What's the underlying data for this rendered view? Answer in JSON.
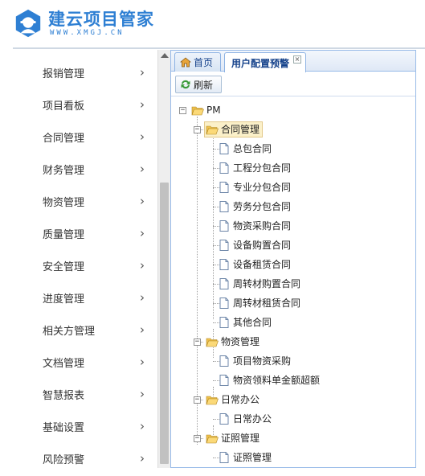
{
  "brand": {
    "title": "建云项目管家",
    "subtitle": "WWW.XMGJ.CN",
    "color": "#2e7fd3",
    "logo_icon": "worker-helmet-icon"
  },
  "sidebar": {
    "items": [
      {
        "label": "报销管理"
      },
      {
        "label": "项目看板"
      },
      {
        "label": "合同管理"
      },
      {
        "label": "财务管理"
      },
      {
        "label": "物资管理"
      },
      {
        "label": "质量管理"
      },
      {
        "label": "安全管理"
      },
      {
        "label": "进度管理"
      },
      {
        "label": "相关方管理"
      },
      {
        "label": "文档管理"
      },
      {
        "label": "智慧报表"
      },
      {
        "label": "基础设置"
      },
      {
        "label": "风险预警"
      }
    ],
    "chevron_icon": "chevron-right-icon"
  },
  "tabs": {
    "home_label": "首页",
    "home_icon": "home-icon",
    "active_label": "用户配置预警",
    "close_icon": "close-icon"
  },
  "toolbar": {
    "refresh_label": "刷新",
    "refresh_icon": "refresh-icon"
  },
  "tree": {
    "root": "PM",
    "groups": [
      {
        "label": "合同管理",
        "selected": true,
        "children": [
          "总包合同",
          "工程分包合同",
          "专业分包合同",
          "劳务分包合同",
          "物资采购合同",
          "设备购置合同",
          "设备租赁合同",
          "周转材购置合同",
          "周转材租赁合同",
          "其他合同"
        ]
      },
      {
        "label": "物资管理",
        "children": [
          "项目物资采购",
          "物资领料单金额超额"
        ]
      },
      {
        "label": "日常办公",
        "children": [
          "日常办公"
        ]
      },
      {
        "label": "证照管理",
        "children": [
          "证照管理"
        ]
      }
    ]
  }
}
